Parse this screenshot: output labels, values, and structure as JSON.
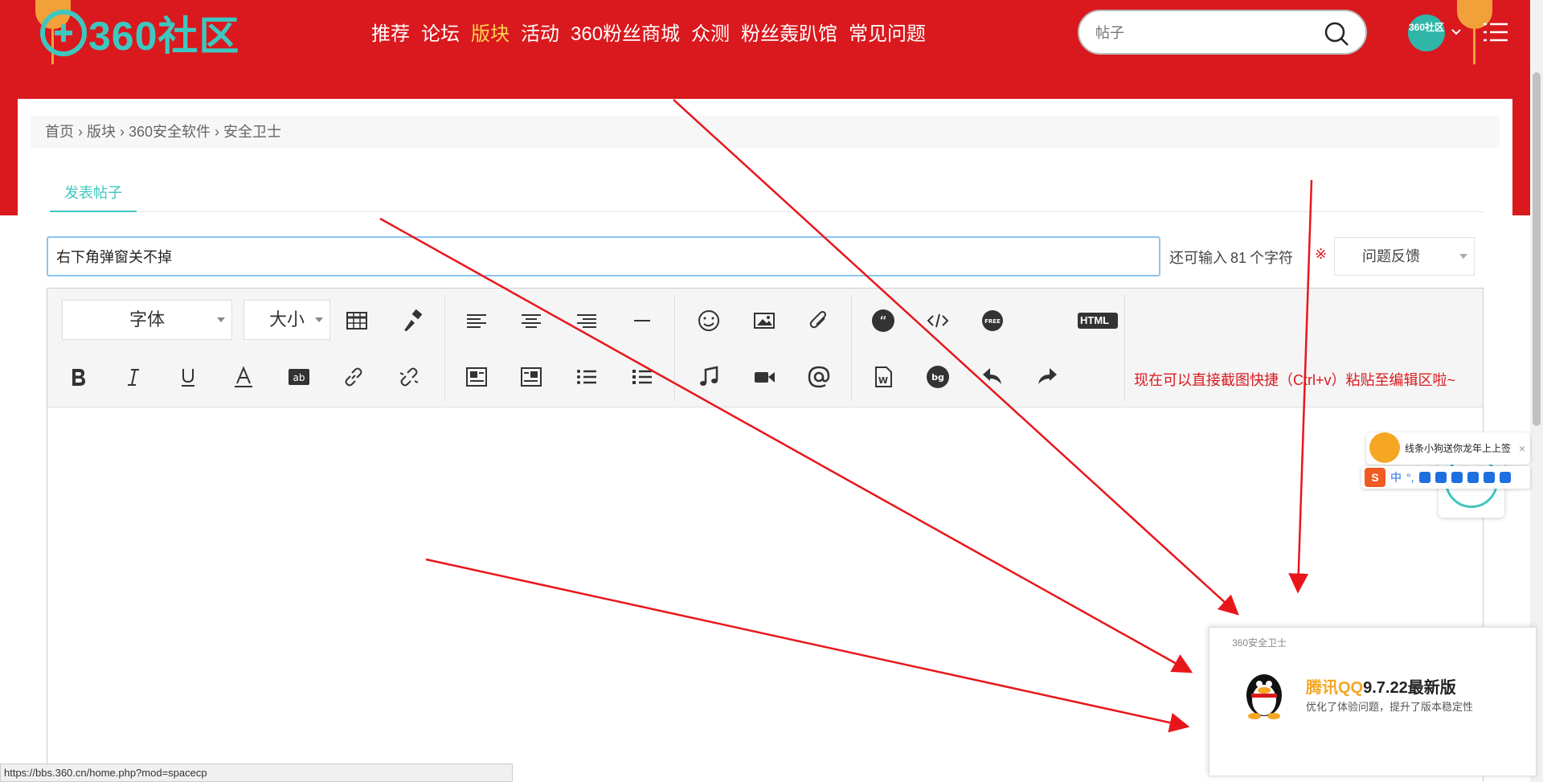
{
  "header": {
    "logo_text": "360社区",
    "nav": [
      {
        "label": "推荐",
        "active": false
      },
      {
        "label": "论坛",
        "active": false
      },
      {
        "label": "版块",
        "active": true
      },
      {
        "label": "活动",
        "active": false
      },
      {
        "label": "360粉丝商城",
        "active": false
      },
      {
        "label": "众测",
        "active": false
      },
      {
        "label": "粉丝轰趴馆",
        "active": false
      },
      {
        "label": "常见问题",
        "active": false
      }
    ],
    "search_placeholder": "帖子",
    "avatar_text": "360社区",
    "colors": {
      "header_bg": "#d9191e",
      "brand": "#3ec7c0",
      "active_nav": "#ffd34d"
    }
  },
  "breadcrumb": [
    "首页",
    "版块",
    "360安全软件",
    "安全卫士"
  ],
  "tabs": [
    {
      "label": "发表帖子",
      "active": true
    }
  ],
  "post": {
    "title_value": "右下角弹窗关不掉",
    "remaining_label": "还可输入",
    "remaining_count": "81",
    "remaining_unit": "个字符",
    "required_mark": "※",
    "category": "问题反馈"
  },
  "editor": {
    "font_select": "字体",
    "size_select": "大小",
    "html_button": "HTML",
    "paste_tip": "现在可以直接截图快捷（Ctrl+v）粘贴至编辑区啦~",
    "icons_row1": [
      "table-icon",
      "format-painter-icon",
      "align-left-icon",
      "align-center-icon",
      "align-right-icon",
      "horizontal-rule-icon",
      "emoji-icon",
      "image-icon",
      "attachment-icon",
      "quote-icon",
      "code-icon",
      "free-icon",
      "html-icon"
    ],
    "icons_row2": [
      "bold-icon",
      "italic-icon",
      "underline-icon",
      "font-color-icon",
      "background-color-icon",
      "link-icon",
      "unlink-icon",
      "float-left-icon",
      "float-right-icon",
      "ordered-list-icon",
      "unordered-list-icon",
      "music-icon",
      "video-icon",
      "mention-icon",
      "word-icon",
      "bg-icon",
      "undo-icon",
      "redo-icon"
    ]
  },
  "ime": {
    "tip": "线条小狗送你龙年上上签",
    "close": "×",
    "logo": "S",
    "mode": "中",
    "punct": "°,"
  },
  "popup": {
    "source": "360安全卫士",
    "brand": "腾讯QQ",
    "version": "9.7.22最新版",
    "description": "优化了体验问题，提升了版本稳定性"
  },
  "status_url": "https://bbs.360.cn/home.php?mod=spacecp"
}
